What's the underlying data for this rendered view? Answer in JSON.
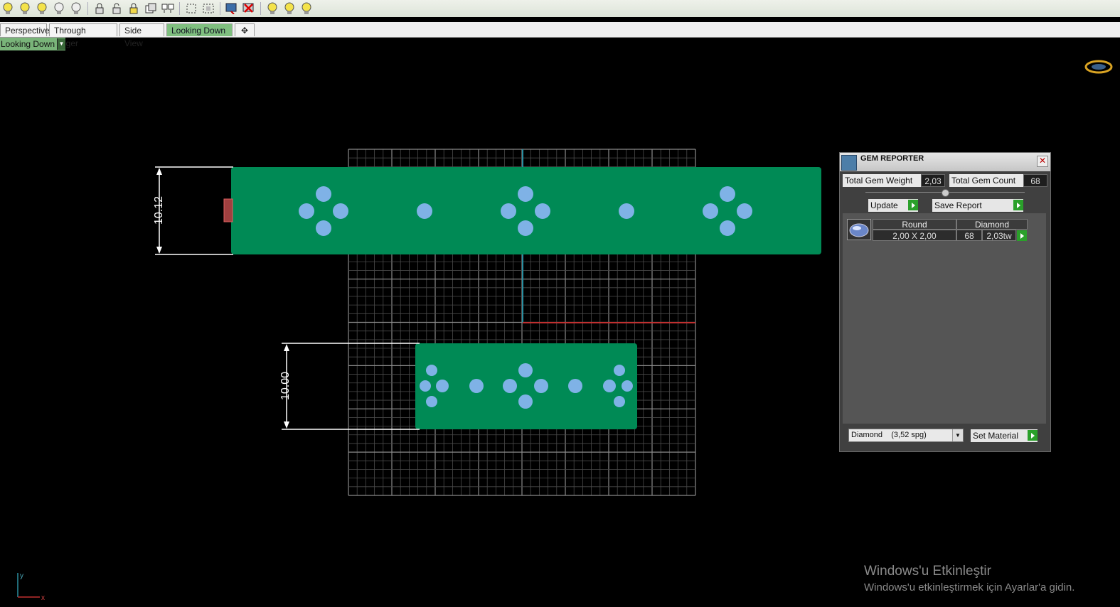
{
  "toolbar": {
    "icons": [
      "bulb-icon",
      "bulb-icon",
      "bulb-icon",
      "bulb-icon",
      "bulb-icon",
      "lock-icon",
      "unlock-icon",
      "lock-icon",
      "layer-icon",
      "layer-icon",
      "select-icon",
      "select-icon",
      "render-icon",
      "close-icon",
      "bulb-icon",
      "bulb-icon",
      "bulb-icon"
    ]
  },
  "tabs": [
    {
      "label": "Perspective",
      "active": false
    },
    {
      "label": "Through Finger",
      "active": false
    },
    {
      "label": "Side View",
      "active": false
    },
    {
      "label": "Looking Down",
      "active": true
    }
  ],
  "viewport": {
    "label": "Looking Down",
    "dimension_top": "10.12",
    "dimension_bottom": "10.00",
    "axis_y": "y",
    "axis_x": "x"
  },
  "gem_reporter": {
    "title": "GEM REPORTER",
    "total_weight_label": "Total Gem Weight",
    "total_weight_value": "2,03",
    "total_count_label": "Total Gem Count",
    "total_count_value": "68",
    "update_label": "Update",
    "save_report_label": "Save Report",
    "table_headers": [
      "Round",
      "Diamond"
    ],
    "rows": [
      {
        "size": "2,00 X 2,00",
        "count": "68",
        "weight": "2,03tw"
      }
    ],
    "material_value": "Diamond    (3,52 spg)",
    "set_material_label": "Set Material"
  },
  "watermark": {
    "line1": "Windows'u Etkinleştir",
    "line2": "Windows'u etkinleştirmek için Ayarlar'a gidin."
  },
  "colors": {
    "ring": "#008a55",
    "gem": "#7fb2e6",
    "grid": "#5a5a5a",
    "active_tab": "#7fbf7f"
  }
}
